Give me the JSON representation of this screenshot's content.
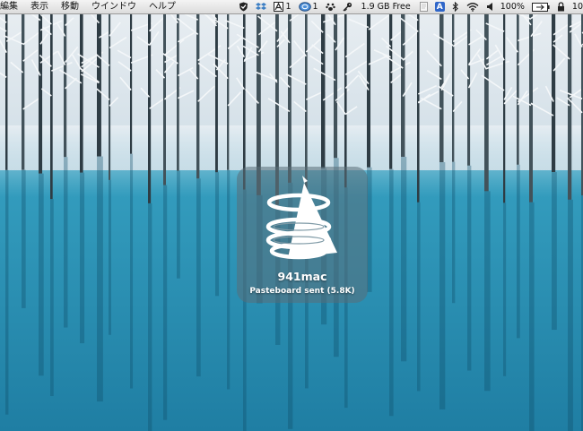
{
  "menubar": {
    "items": [
      "編集",
      "表示",
      "移動",
      "ウインドウ",
      "ヘルプ"
    ]
  },
  "status": {
    "notify_count_a": "1",
    "notify_count_b": "1",
    "free_memory": "1.9 GB Free",
    "ime_label": "A",
    "battery_percent": "100%",
    "clock_partial": "10"
  },
  "icons": {
    "status_icons": [
      "shield-check-icon",
      "dropbox-icon",
      "adobe-icon",
      "cloud-badge-icon",
      "paw-icon",
      "key-icon",
      "document-icon",
      "bluetooth-icon",
      "wifi-icon",
      "volume-icon",
      "battery-icon",
      "lock-icon"
    ],
    "hud_icon": "triangle-rings-icon"
  },
  "hud": {
    "title": "941mac",
    "subtitle": "Pasteboard sent (5.8K)"
  },
  "colors": {
    "water": "#3aa6c6",
    "snow": "#f3f6f8",
    "hud_bg": "#5a6e78"
  }
}
